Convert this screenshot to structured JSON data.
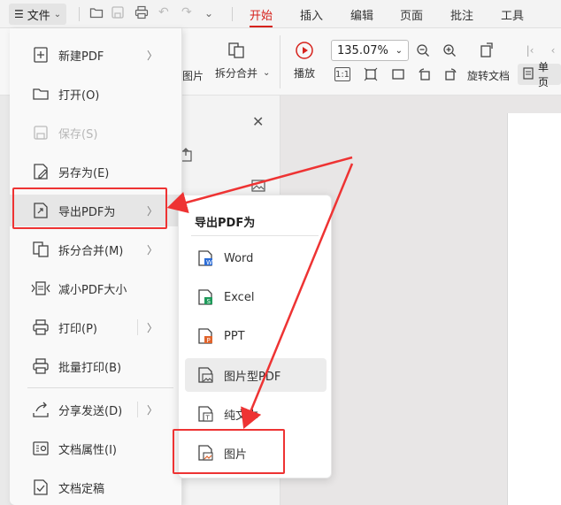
{
  "topbar": {
    "file_label": "文件",
    "tabs": [
      "开始",
      "插入",
      "编辑",
      "页面",
      "批注",
      "工具"
    ]
  },
  "ribbon": {
    "image_label": "图片",
    "split_merge_label": "拆分合并",
    "play_label": "播放",
    "zoom_value": "135.07%",
    "rotate_label": "旋转文档",
    "single_page_label": "单页",
    "ratio_label": "1:1"
  },
  "file_menu": {
    "items": [
      {
        "label": "新建PDF"
      },
      {
        "label": "打开(O)"
      },
      {
        "label": "保存(S)"
      },
      {
        "label": "另存为(E)"
      },
      {
        "label": "导出PDF为"
      },
      {
        "label": "拆分合并(M)"
      },
      {
        "label": "减小PDF大小"
      },
      {
        "label": "打印(P)"
      },
      {
        "label": "批量打印(B)"
      },
      {
        "label": "分享发送(D)"
      },
      {
        "label": "文档属性(I)"
      },
      {
        "label": "文档定稿"
      }
    ]
  },
  "submenu": {
    "title": "导出PDF为",
    "items": [
      {
        "label": "Word"
      },
      {
        "label": "Excel"
      },
      {
        "label": "PPT"
      },
      {
        "label": "图片型PDF"
      },
      {
        "label": "纯文本"
      },
      {
        "label": "图片"
      }
    ]
  },
  "colors": {
    "accent": "#d6221c",
    "highlight_box": "#e33333",
    "word_blue": "#2b6cd6",
    "excel_green": "#1f9a5a",
    "ppt_orange": "#e0642c"
  }
}
